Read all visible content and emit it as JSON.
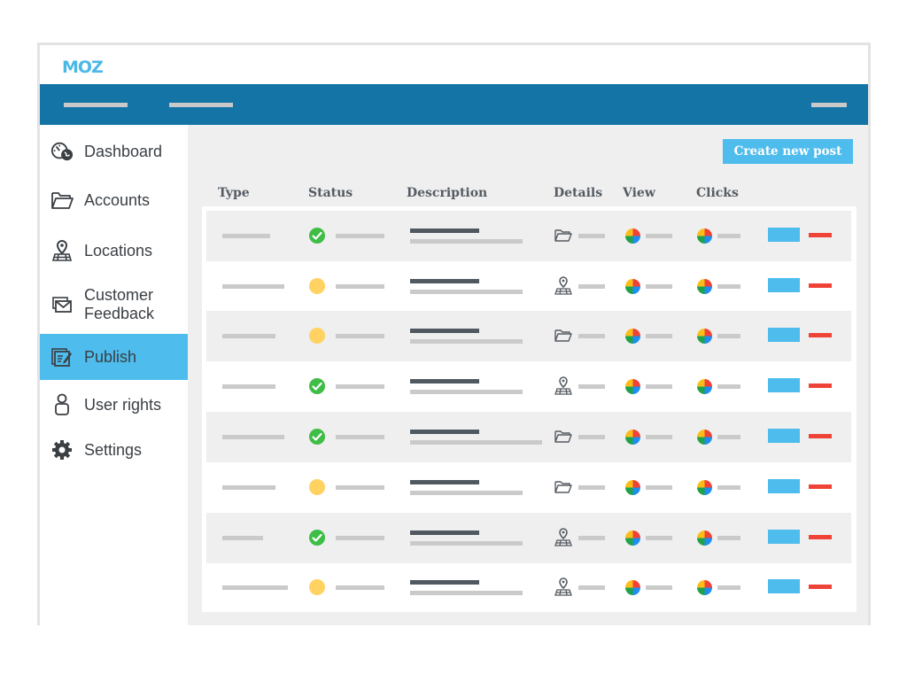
{
  "app": {
    "logo": "MOZ"
  },
  "colors": {
    "nav": "#1474a6",
    "accent": "#4ebcec",
    "success": "#3fbd47",
    "pending": "#ffd262",
    "danger": "#f04338"
  },
  "sidebar": {
    "items": [
      {
        "label": "Dashboard",
        "icon": "dashboard-globe-icon",
        "active": false
      },
      {
        "label": "Accounts",
        "icon": "folder-icon",
        "active": false
      },
      {
        "label": "Locations",
        "icon": "location-pin-map-icon",
        "active": false
      },
      {
        "label": "Customer Feedback",
        "icon": "envelope-icon",
        "active": false
      },
      {
        "label": "Publish",
        "icon": "publish-edit-icon",
        "active": true
      },
      {
        "label": "User rights",
        "icon": "user-icon",
        "active": false
      },
      {
        "label": "Settings",
        "icon": "gear-icon",
        "active": false
      }
    ]
  },
  "main": {
    "create_button": "Create new post",
    "columns": [
      "Type",
      "Status",
      "Description",
      "Details",
      "View",
      "Clicks"
    ],
    "rows": [
      {
        "status": "done",
        "details_icon": "folder"
      },
      {
        "status": "pending",
        "details_icon": "location"
      },
      {
        "status": "pending",
        "details_icon": "folder"
      },
      {
        "status": "done",
        "details_icon": "location"
      },
      {
        "status": "done",
        "details_icon": "folder"
      },
      {
        "status": "pending",
        "details_icon": "folder"
      },
      {
        "status": "done",
        "details_icon": "location"
      },
      {
        "status": "pending",
        "details_icon": "location"
      }
    ]
  }
}
